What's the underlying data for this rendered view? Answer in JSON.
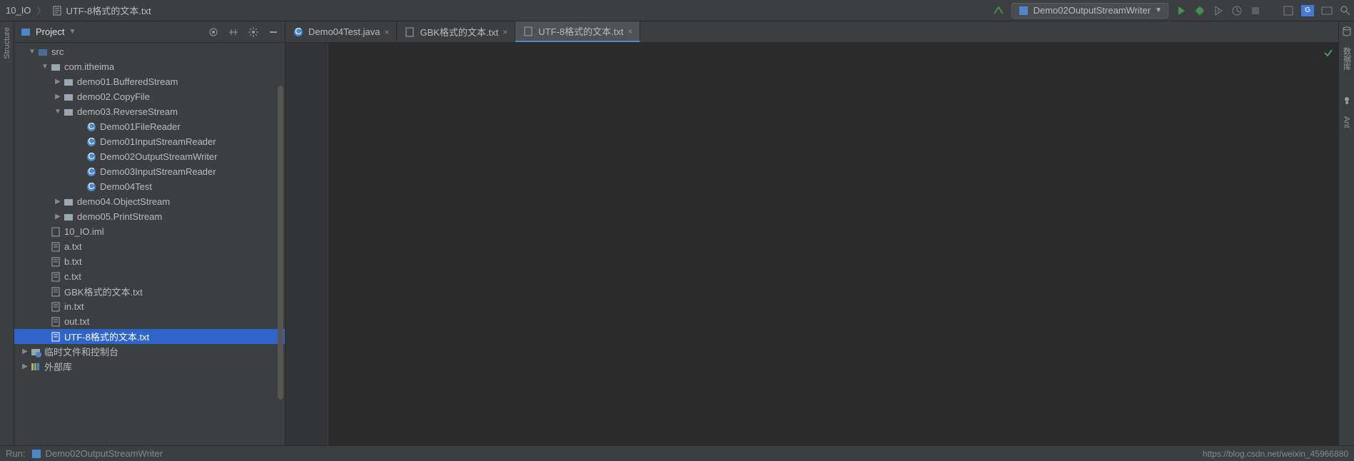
{
  "breadcrumb": {
    "root": "10_IO",
    "file": "UTF-8格式的文本.txt"
  },
  "runConfig": {
    "name": "Demo02OutputStreamWriter"
  },
  "projectPanel": {
    "title": "Project",
    "tree": {
      "src": "src",
      "package": "com.itheima",
      "folders": {
        "demo01": "demo01.BufferedStream",
        "demo02": "demo02.CopyFile",
        "demo03": "demo03.ReverseStream",
        "demo04": "demo04.ObjectStream",
        "demo05": "demo05.PrintStream"
      },
      "classes": {
        "c1": "Demo01FileReader",
        "c2": "Demo01InputStreamReader",
        "c3": "Demo02OutputStreamWriter",
        "c4": "Demo03InputStreamReader",
        "c5": "Demo04Test"
      },
      "files": {
        "iml": "10_IO.iml",
        "a": "a.txt",
        "b": "b.txt",
        "c": "c.txt",
        "gbk": "GBK格式的文本.txt",
        "in": "in.txt",
        "out": "out.txt",
        "utf8": "UTF-8格式的文本.txt"
      },
      "tempConsole": "临时文件和控制台",
      "externalLibs": "外部库"
    }
  },
  "tabs": {
    "t1": "Demo04Test.java",
    "t2": "GBK格式的文本.txt",
    "t3": "UTF-8格式的文本.txt"
  },
  "rightStripe": {
    "db": "数据库",
    "ant": "Ant"
  },
  "leftStripe": {
    "structure": "Structure"
  },
  "bottom": {
    "run": "Run:",
    "config": "Demo02OutputStreamWriter"
  },
  "watermark": "https://blog.csdn.net/weixin_45966880"
}
